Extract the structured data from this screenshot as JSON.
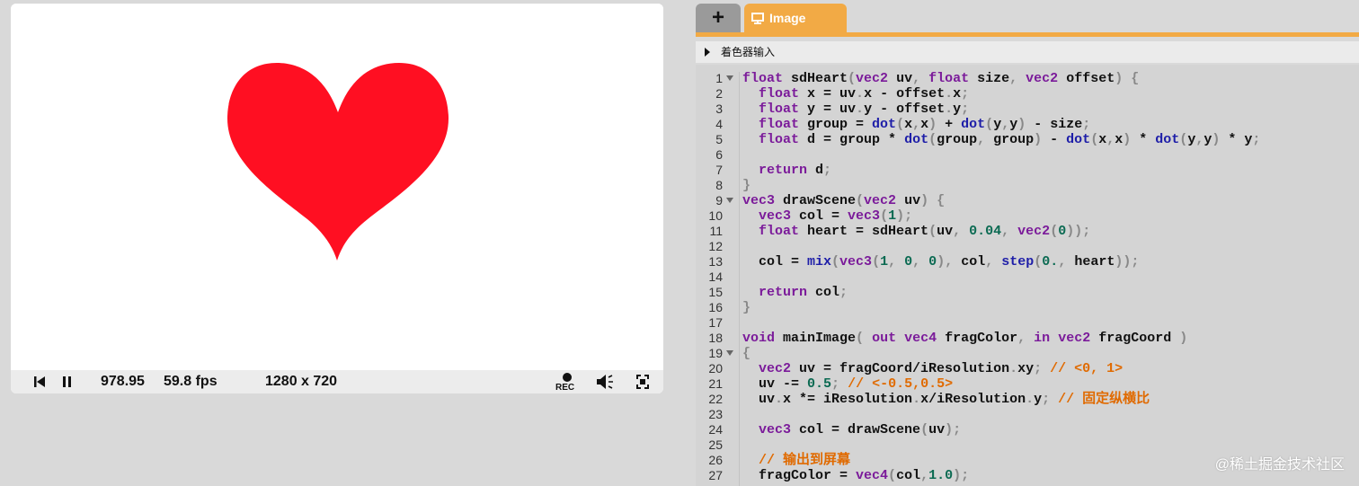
{
  "player": {
    "time": "978.95",
    "fps": "59.8 fps",
    "resolution": "1280 x 720",
    "rec_label": "REC",
    "heart_color": "#ff0f22"
  },
  "tabs": {
    "add_label": "+",
    "image_label": "Image",
    "accent": "#f2aa45"
  },
  "inputs_label": "着色器输入",
  "code": {
    "lines": [
      {
        "n": "1",
        "fold": true,
        "t": "float sdHeart(vec2 uv, float size, vec2 offset) {"
      },
      {
        "n": "2",
        "fold": false,
        "t": "  float x = uv.x - offset.x;"
      },
      {
        "n": "3",
        "fold": false,
        "t": "  float y = uv.y - offset.y;"
      },
      {
        "n": "4",
        "fold": false,
        "t": "  float group = dot(x,x) + dot(y,y) - size;"
      },
      {
        "n": "5",
        "fold": false,
        "t": "  float d = group * dot(group, group) - dot(x,x) * dot(y,y) * y;"
      },
      {
        "n": "6",
        "fold": false,
        "t": ""
      },
      {
        "n": "7",
        "fold": false,
        "t": "  return d;"
      },
      {
        "n": "8",
        "fold": false,
        "t": "}"
      },
      {
        "n": "9",
        "fold": true,
        "t": "vec3 drawScene(vec2 uv) {"
      },
      {
        "n": "10",
        "fold": false,
        "t": "  vec3 col = vec3(1);"
      },
      {
        "n": "11",
        "fold": false,
        "t": "  float heart = sdHeart(uv, 0.04, vec2(0));"
      },
      {
        "n": "12",
        "fold": false,
        "t": ""
      },
      {
        "n": "13",
        "fold": false,
        "t": "  col = mix(vec3(1, 0, 0), col, step(0., heart));"
      },
      {
        "n": "14",
        "fold": false,
        "t": ""
      },
      {
        "n": "15",
        "fold": false,
        "t": "  return col;"
      },
      {
        "n": "16",
        "fold": false,
        "t": "}"
      },
      {
        "n": "17",
        "fold": false,
        "t": ""
      },
      {
        "n": "18",
        "fold": false,
        "t": "void mainImage( out vec4 fragColor, in vec2 fragCoord )"
      },
      {
        "n": "19",
        "fold": true,
        "t": "{"
      },
      {
        "n": "20",
        "fold": false,
        "t": "  vec2 uv = fragCoord/iResolution.xy; // <0, 1>"
      },
      {
        "n": "21",
        "fold": false,
        "t": "  uv -= 0.5; // <-0.5,0.5>"
      },
      {
        "n": "22",
        "fold": false,
        "t": "  uv.x *= iResolution.x/iResolution.y; // 固定纵横比"
      },
      {
        "n": "23",
        "fold": false,
        "t": ""
      },
      {
        "n": "24",
        "fold": false,
        "t": "  vec3 col = drawScene(uv);"
      },
      {
        "n": "25",
        "fold": false,
        "t": ""
      },
      {
        "n": "26",
        "fold": false,
        "t": "  // 输出到屏幕"
      },
      {
        "n": "27",
        "fold": false,
        "t": "  fragColor = vec4(col,1.0);"
      }
    ]
  },
  "watermark": "@稀土掘金技术社区"
}
